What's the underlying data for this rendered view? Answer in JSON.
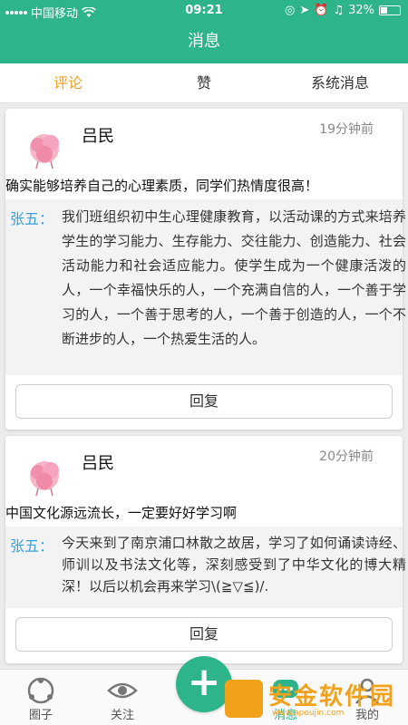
{
  "status_bar": {
    "carrier": "中国移动",
    "time": "09:21",
    "battery": "32%"
  },
  "header": {
    "title": "消息"
  },
  "tabs": [
    {
      "label": "评论",
      "active": true
    },
    {
      "label": "赞",
      "active": false
    },
    {
      "label": "系统消息",
      "active": false
    }
  ],
  "posts": [
    {
      "author": "吕民",
      "time": "19分钟前",
      "comment": "确实能够培养自己的心理素质，同学们热情度很高！",
      "reply_name": "张五：",
      "reply_text": "我们班组织初中生心理健康教育，以活动课的方式来培养学生的学习能力、生存能力、交往能力、创造能力、社会活动能力和社会适应能力。使学生成为一个健康活泼的人，一个幸福快乐的人，一个充满自信的人，一个善于学习的人，一个善于思考的人，一个善于创造的人，一个不断进步的人，一个热爱生活的人。",
      "reply_button": "回复"
    },
    {
      "author": "吕民",
      "time": "20分钟前",
      "comment": "中国文化源远流长，一定要好好学习啊",
      "reply_name": "张五：",
      "reply_text": "今天来到了南京浦口林散之故居，学习了如何诵读诗经、师训以及书法文化等，深刻感受到了中华文化的博大精深！以后以机会再来学习\\(≧▽≦)/.",
      "reply_button": "回复"
    }
  ],
  "bottom_nav": [
    {
      "label": "圈子",
      "icon": "circle-people-icon"
    },
    {
      "label": "关注",
      "icon": "eye-icon"
    },
    {
      "label": "消息",
      "icon": "chat-icon",
      "active": true
    },
    {
      "label": "我的",
      "icon": "person-icon"
    }
  ],
  "add_button": {
    "label": "+"
  },
  "watermark": {
    "text": "安金软件园",
    "url": "www.apoujin.com"
  },
  "colors": {
    "primary": "#2db48a",
    "tab_active": "#f0a020",
    "reply_name": "#3aa0d8",
    "watermark": "#f2a11b"
  }
}
